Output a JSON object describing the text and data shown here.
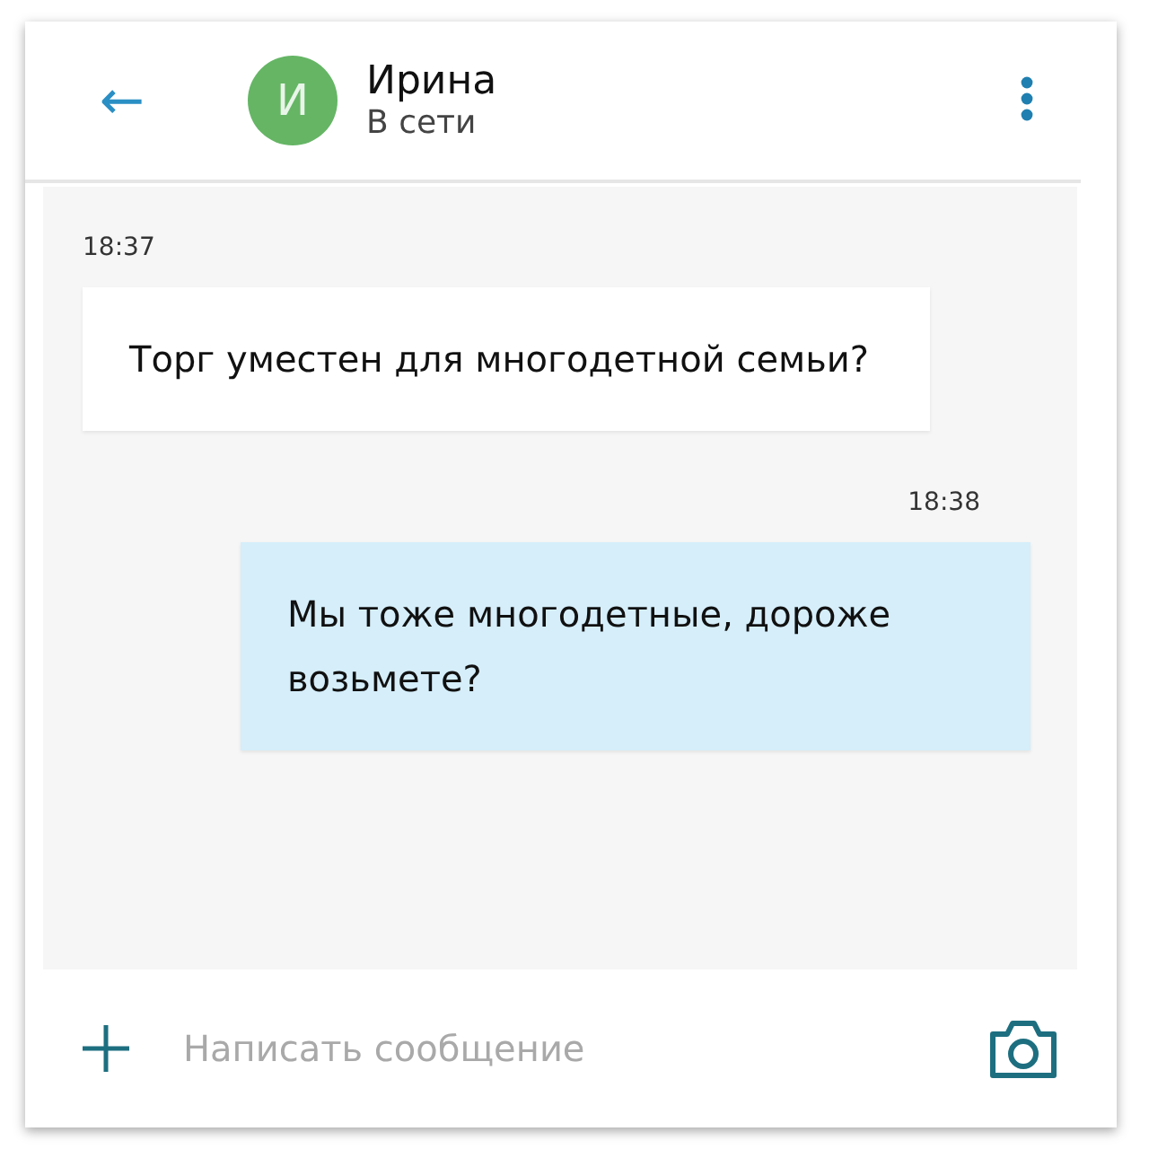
{
  "header": {
    "back": "←",
    "avatar_letter": "И",
    "name": "Ирина",
    "status": "В сети"
  },
  "messages": [
    {
      "kind": "incoming",
      "time": "18:37",
      "text": "Торг уместен для многодетной семьи?"
    },
    {
      "kind": "outgoing",
      "time": "18:38",
      "text": "Мы тоже многодетные, дороже возьмете?"
    }
  ],
  "composer": {
    "placeholder": "Написать сообщение"
  }
}
